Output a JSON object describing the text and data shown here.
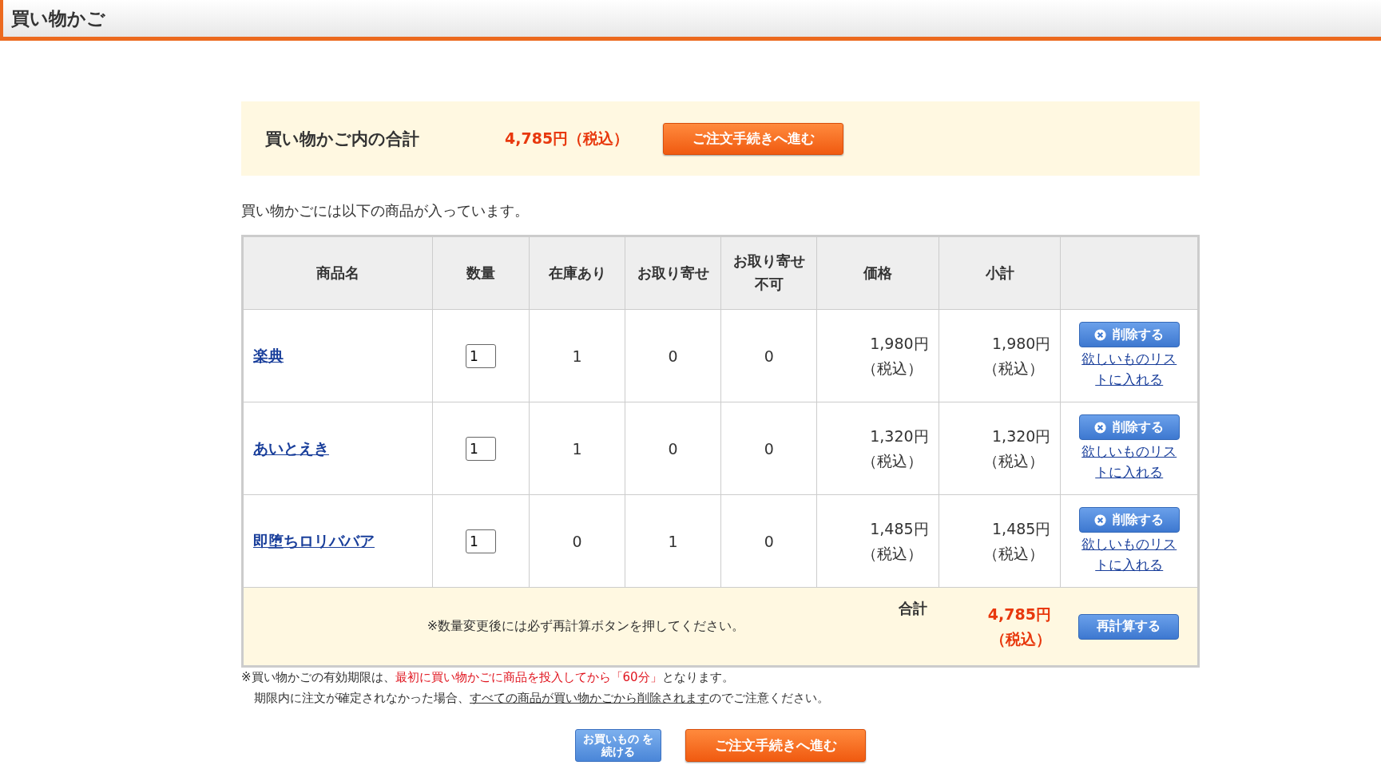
{
  "page_title": "買い物かご",
  "summary": {
    "label": "買い物かご内の合計",
    "total": "4,785円（税込）",
    "checkout_button": "ご注文手続きへ進む"
  },
  "intro": "買い物かごには以下の商品が入っています。",
  "table": {
    "columns": [
      "商品名",
      "数量",
      "在庫あり",
      "お取り寄せ",
      "お取り寄せ不可",
      "価格",
      "小計"
    ],
    "rows": [
      {
        "name": "楽典",
        "quantity": "1",
        "in_stock": "1",
        "order": "0",
        "unavailable": "0",
        "price": "1,980円",
        "price_tax": "（税込）",
        "subtotal": "1,980円",
        "subtotal_tax": "（税込）",
        "delete_button": "削除する",
        "wishlist_link": "欲しいものリストに入れる"
      },
      {
        "name": "あいとえき",
        "quantity": "1",
        "in_stock": "1",
        "order": "0",
        "unavailable": "0",
        "price": "1,320円",
        "price_tax": "（税込）",
        "subtotal": "1,320円",
        "subtotal_tax": "（税込）",
        "delete_button": "削除する",
        "wishlist_link": "欲しいものリストに入れる"
      },
      {
        "name": "即堕ちロリババア",
        "quantity": "1",
        "in_stock": "0",
        "order": "1",
        "unavailable": "0",
        "price": "1,485円",
        "price_tax": "（税込）",
        "subtotal": "1,485円",
        "subtotal_tax": "（税込）",
        "delete_button": "削除する",
        "wishlist_link": "欲しいものリストに入れる"
      }
    ],
    "footer": {
      "note": "※数量変更後には必ず再計算ボタンを押してください。",
      "total_label": "合計",
      "total": "4,785円",
      "total_tax": "（税込）",
      "recalc_button": "再計算する"
    }
  },
  "notes": [
    [
      {
        "kind": "plain",
        "text": "※買い物かごの有効期限は、"
      },
      {
        "kind": "alert",
        "text": "最初に買い物かごに商品を投入してから「60分」"
      },
      {
        "kind": "plain",
        "text": "となります。"
      }
    ],
    [
      {
        "kind": "plain",
        "text": "期限内に注文が確定されなかった場合、"
      },
      {
        "kind": "underline",
        "text": "すべての商品が買い物かごから削除されます"
      },
      {
        "kind": "plain",
        "text": "のでご注意ください。"
      }
    ]
  ],
  "bottom_buttons": {
    "continue": "お買いもの を続ける",
    "checkout": "ご注文手続きへ進む"
  }
}
